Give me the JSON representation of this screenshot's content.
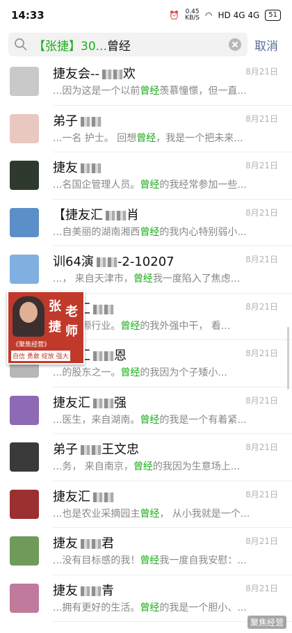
{
  "status": {
    "time": "14:33",
    "speed_value": "0.45",
    "speed_unit": "KB/S",
    "network": "HD 4G 4G",
    "battery": "51"
  },
  "search": {
    "query_prefix": "【张捷】30...",
    "query_highlight": "曾经",
    "cancel_label": "取消"
  },
  "results": [
    {
      "name": "捷友会--",
      "name_tail": "欢",
      "date": "8月21日",
      "pre": "...因为这是一个以前",
      "hl": "曾经",
      "post": "羡慕憧憬，但一直...",
      "avatar": "#c9c9c9"
    },
    {
      "name": "弟子",
      "name_tail": "",
      "date": "8月21日",
      "pre": "...一名 护士。 回想",
      "hl": "曾经",
      "post": "，我是一个把未来...",
      "avatar": "#e8c8c0"
    },
    {
      "name": "捷友",
      "name_tail": "",
      "date": "8月21日",
      "pre": "...名国企管理人员。",
      "hl": "曾经",
      "post": "的我经常参加一些...",
      "avatar": "#2e3a2e"
    },
    {
      "name": "【捷友汇",
      "name_tail": "肖",
      "date": "8月21日",
      "pre": "...自美丽的湖南湘西",
      "hl": "曾经",
      "post": "的我内心特别弱小...",
      "avatar": "#5b8fc7"
    },
    {
      "name": "训64演",
      "name_tail": "-2-10207",
      "date": "8月21日",
      "pre": "...， 来自天津市，",
      "hl": "曾经",
      "post": "我一度陷入了焦虑...",
      "avatar": "#7fb0e0"
    },
    {
      "name": "捷友汇",
      "name_tail": "",
      "date": "8月21日",
      "pre": "...力资源行业。",
      "hl": "曾经",
      "post": "的我外强中干， 看...",
      "avatar": "#a0a0a0"
    },
    {
      "name": "捷友汇",
      "name_tail": "恩",
      "date": "8月21日",
      "pre": "...的股东之一。",
      "hl": "曾经",
      "post": "的我因为个子矮小...",
      "avatar": "#b7b7b7"
    },
    {
      "name": "捷友汇",
      "name_tail": "强",
      "date": "8月21日",
      "pre": "...医生，来自湖南。",
      "hl": "曾经",
      "post": "的我是一个有着紧...",
      "avatar": "#8d6ab3"
    },
    {
      "name": "弟子",
      "name_tail": "王文忠",
      "date": "8月21日",
      "pre": "...务， 来自南京，",
      "hl": "曾经",
      "post": "的我因为生意场上...",
      "avatar": "#3a3a3a"
    },
    {
      "name": "捷友汇",
      "name_tail": "",
      "date": "8月21日",
      "pre": "...也是农业采摘园主",
      "hl": "曾经",
      "post": "， 从小我就是一个...",
      "avatar": "#9b3030"
    },
    {
      "name": "捷友",
      "name_tail": "君",
      "date": "8月21日",
      "pre": "...没有目标感的我！",
      "hl": "曾经",
      "post": "我一度自我安慰：...",
      "avatar": "#6f9a5a"
    },
    {
      "name": "捷友",
      "name_tail": "青",
      "date": "8月21日",
      "pre": "...拥有更好的生活。",
      "hl": "曾经",
      "post": "的我是一个胆小、...",
      "avatar": "#c07a9c"
    }
  ],
  "promo": {
    "chars": [
      "张",
      "老",
      "捷",
      "师"
    ],
    "line1": "《聚焦经营》",
    "line2": "自信 勇敢 绽放 强大"
  },
  "watermark": "聚焦经营"
}
